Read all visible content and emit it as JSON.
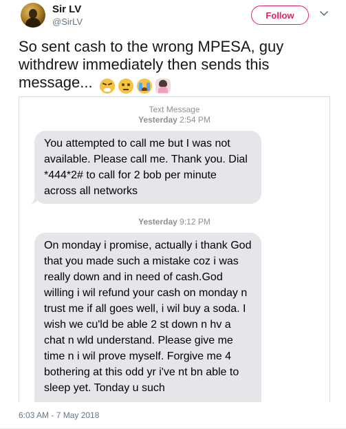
{
  "user": {
    "name": "Sir LV",
    "handle": "@SirLV",
    "follow_label": "Follow"
  },
  "tweet": {
    "text": "So sent cash to the wrong MPESA, guy withdrew immediately then sends this message...",
    "emojis": [
      "triumph-face-emoji",
      "rolling-eyes-emoji",
      "crying-face-emoji",
      "woman-facepalming-emoji"
    ],
    "timestamp": "6:03 AM - 7 May 2018"
  },
  "message_screenshot": {
    "header_title": "Text Message",
    "header_time_bold": "Yesterday",
    "header_time": "2:54 PM",
    "message1": "You attempted to call me but I was not available. Please call me. Thank you. Dial *444*2# to call for 2 bob per minute across all networks",
    "divider_time_bold": "Yesterday",
    "divider_time": "9:12 PM",
    "message2": "On monday i promise, actually i thank God that you made such a mistake coz i was really down and in need of cash.God willing i wil refund your cash on monday n trust me if all goes well, i wil buy a soda. I wish we cu'ld be able 2 st down n hv a chat n wld understand. Please give me time n i wil prove myself. Forgive me 4 bothering at this odd yr i've nt bn able to sleep yet. Tonday u such"
  },
  "colors": {
    "follow_accent": "#e0245e",
    "bubble_bg": "#e5e5ea",
    "secondary_text": "#657786"
  }
}
